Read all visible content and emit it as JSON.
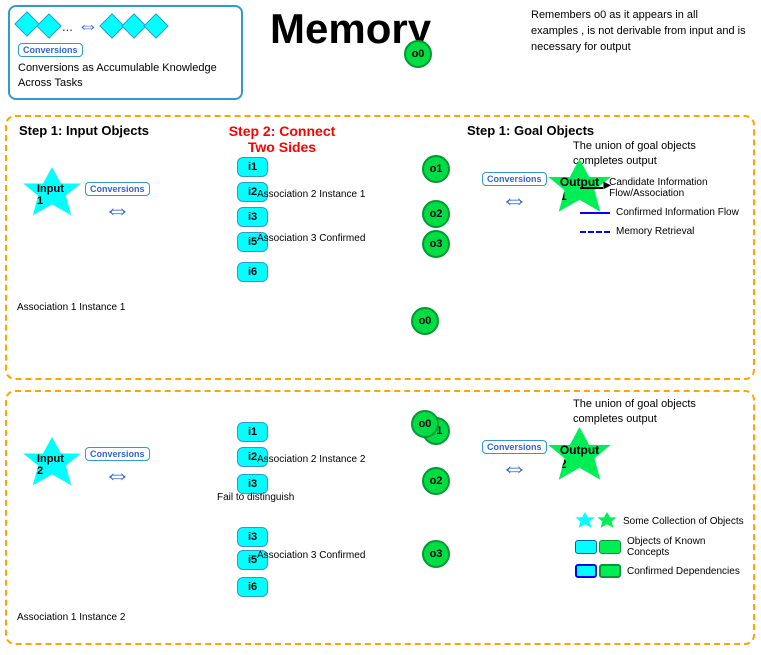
{
  "title": "Memory",
  "memory_note": "Remembers o0 as it appears in all examples , is not derivable from input and is necessary for output",
  "top_box_label": "Conversions as Accumulable Knowledge Across Tasks",
  "step1_left_label": "Step 1: Input Objects",
  "step2_center_label": "Step 2: Connect\nTwo Sides",
  "step1_right_label": "Step 1: Goal Objects",
  "goal_union_text": "The union of goal objects\ncompletes output",
  "assoc1": "Association 1 Instance 1",
  "assoc2_1": "Association 2 Instance 1",
  "assoc3_confirmed": "Association 3 Confirmed",
  "assoc1_inst2": "Association 1 Instance 2",
  "assoc2_2": "Association 2 Instance 2",
  "assoc3_confirmed2": "Association 3 Confirmed",
  "fail_to_distinguish": "Fail to distinguish",
  "legend": {
    "candidate": "Candidate Information Flow/Association",
    "confirmed": "Confirmed Information Flow",
    "memory": "Memory Retrieval"
  },
  "legend2": {
    "some_collection": "Some Collection of Objects",
    "known_concepts": "Objects of Known Concepts",
    "confirmed_deps": "Confirmed Dependencies"
  },
  "nodes": {
    "o0_top": "o0",
    "o0_mid": "o0",
    "o0_bot": "o0",
    "o1": "o1",
    "o2": "o2",
    "o3": "o3",
    "i1": "i1",
    "i2": "i2",
    "i3": "i3",
    "i5": "i5",
    "i6": "i6"
  },
  "input_labels": [
    "Input 1",
    "Input 2"
  ],
  "output_labels": [
    "Output 1",
    "Output 2"
  ],
  "conversions_label": "Conversions"
}
